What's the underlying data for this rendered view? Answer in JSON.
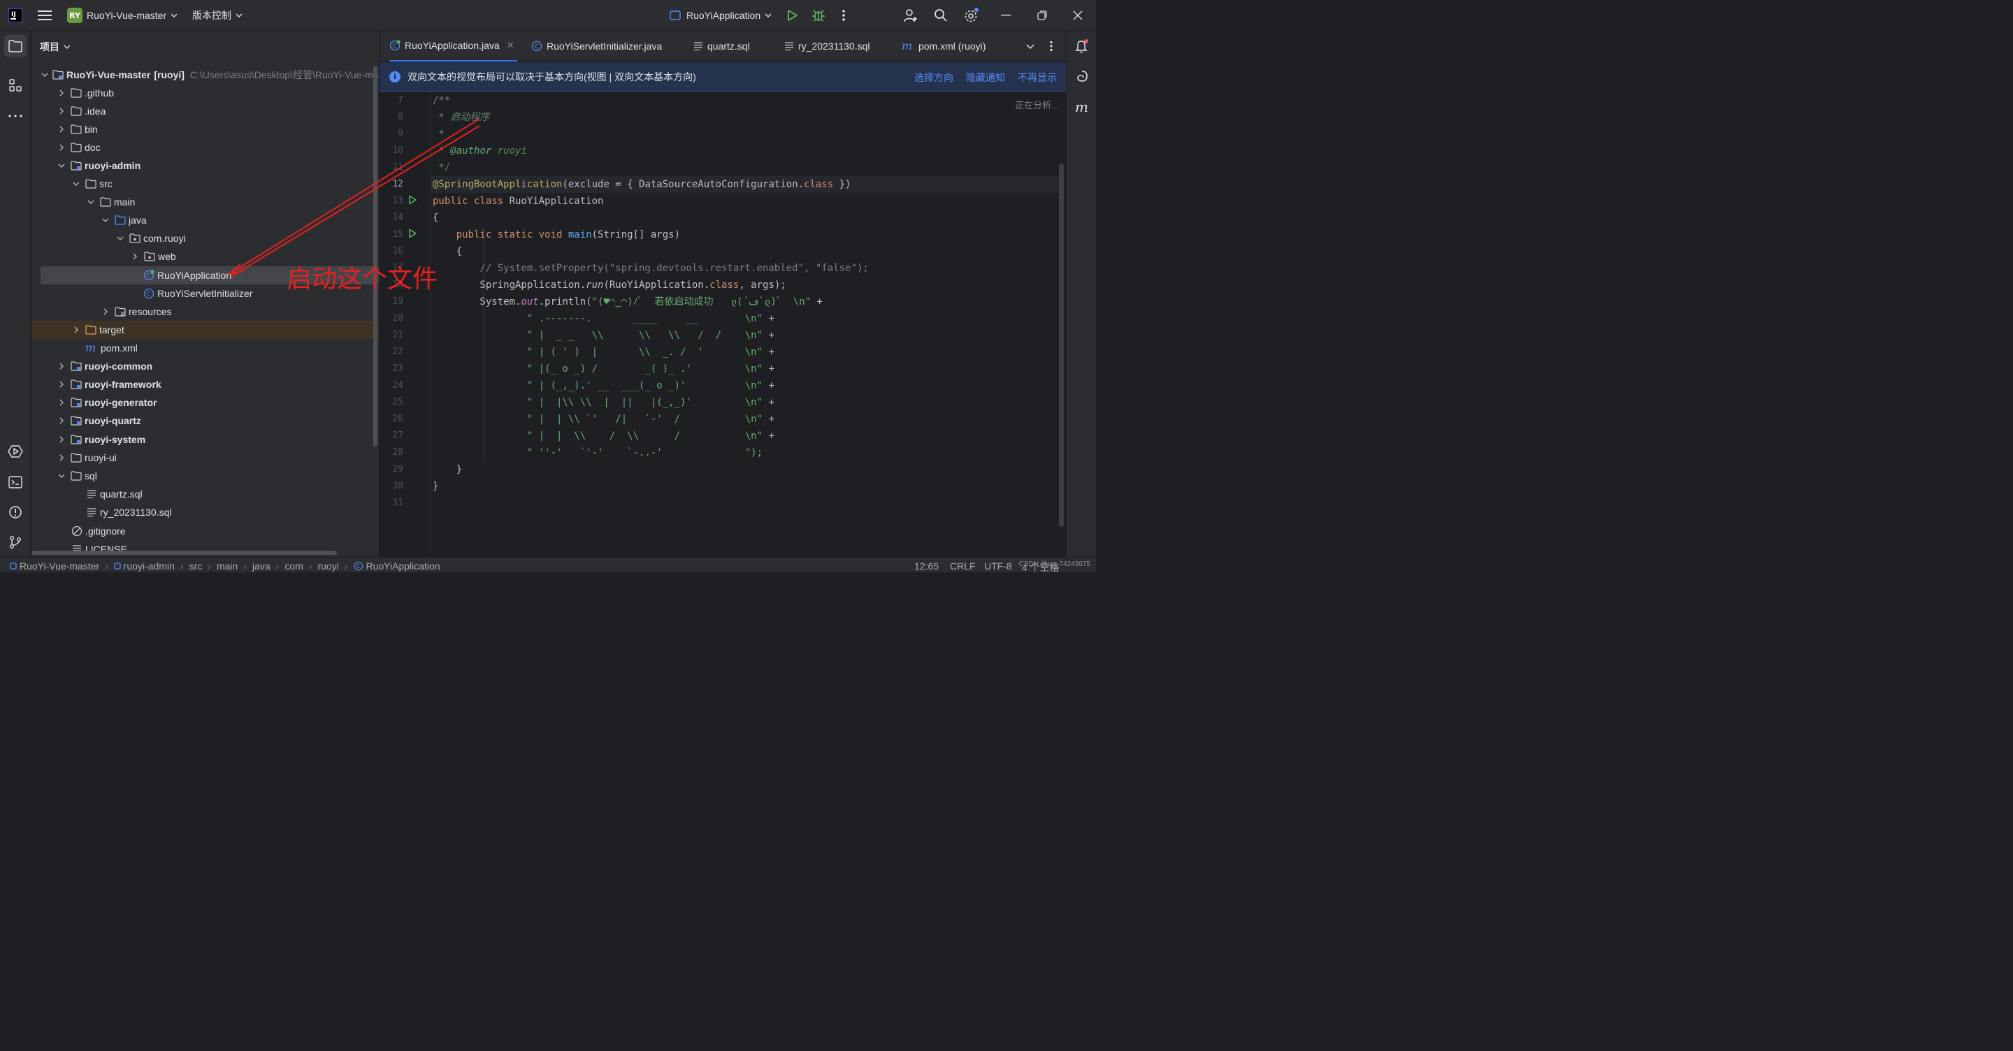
{
  "titlebar": {
    "project_badge": "RY",
    "project_name": "RuoYi-Vue-master",
    "vcs_label": "版本控制",
    "run_config": "RuoYiApplication"
  },
  "panel": {
    "title": "项目",
    "tree": [
      {
        "id": "root",
        "label": "RuoYi-Vue-master",
        "suffix": "[ruoyi]",
        "hint": "C:\\Users\\asus\\Desktop\\经管\\RuoYi-Vue-mas"
      },
      {
        "id": "github",
        "label": ".github"
      },
      {
        "id": "idea",
        "label": ".idea"
      },
      {
        "id": "bin",
        "label": "bin"
      },
      {
        "id": "doc",
        "label": "doc"
      },
      {
        "id": "admin",
        "label": "ruoyi-admin"
      },
      {
        "id": "src",
        "label": "src"
      },
      {
        "id": "main",
        "label": "main"
      },
      {
        "id": "java",
        "label": "java"
      },
      {
        "id": "comruoyi",
        "label": "com.ruoyi"
      },
      {
        "id": "web",
        "label": "web"
      },
      {
        "id": "ruoyiapp",
        "label": "RuoYiApplication"
      },
      {
        "id": "servletinit",
        "label": "RuoYiServletInitializer"
      },
      {
        "id": "resources",
        "label": "resources"
      },
      {
        "id": "target",
        "label": "target"
      },
      {
        "id": "pom",
        "label": "pom.xml"
      },
      {
        "id": "common",
        "label": "ruoyi-common"
      },
      {
        "id": "framework",
        "label": "ruoyi-framework"
      },
      {
        "id": "generator",
        "label": "ruoyi-generator"
      },
      {
        "id": "quartz",
        "label": "ruoyi-quartz"
      },
      {
        "id": "system",
        "label": "ruoyi-system"
      },
      {
        "id": "ui",
        "label": "ruoyi-ui"
      },
      {
        "id": "sql",
        "label": "sql"
      },
      {
        "id": "quartzsql",
        "label": "quartz.sql"
      },
      {
        "id": "rysql",
        "label": "ry_20231130.sql"
      },
      {
        "id": "gitignore",
        "label": ".gitignore"
      },
      {
        "id": "license",
        "label": "LICENSE"
      }
    ]
  },
  "tabs": [
    {
      "label": "RuoYiApplication.java",
      "icon": "java-class-icon",
      "active": true
    },
    {
      "label": "RuoYiServletInitializer.java",
      "icon": "java-class-icon"
    },
    {
      "label": "quartz.sql",
      "icon": "sql-file-icon"
    },
    {
      "label": "ry_20231130.sql",
      "icon": "sql-file-icon"
    },
    {
      "label": "pom.xml (ruoyi)",
      "icon": "maven-icon"
    }
  ],
  "notification": {
    "text": "双向文本的视觉布局可以取决于基本方向(视图 | 双向文本基本方向)",
    "action_choose": "选择方向",
    "action_hide": "隐藏通知",
    "action_never": "不再显示"
  },
  "editor": {
    "analysing": "正在分析...",
    "line_numbers": [
      "7",
      "8",
      "9",
      "10",
      "11",
      "12",
      "13",
      "14",
      "15",
      "16",
      "17",
      "18",
      "19",
      "20",
      "21",
      "22",
      "23",
      "24",
      "25",
      "26",
      "27",
      "28",
      "29",
      "30",
      "31"
    ],
    "code": {
      "l7": "/**",
      "l8_star": " * ",
      "l8_doc": "启动程序",
      "l9": " *",
      "l10_star": " * ",
      "l10_tag": "@author",
      "l10_val": " ruoyi",
      "l11": " */",
      "l12_ann": "@SpringBootApplication",
      "l12_rest": "(exclude = { DataSourceAutoConfiguration.",
      "l12_kw": "class",
      "l12_end": " })",
      "l13_kw": "public class",
      "l13_name": " RuoYiApplication",
      "l14": "{",
      "l15_kw": "    public static void",
      "l15_fn": " main",
      "l15_rest": "(String[] args)",
      "l16": "    {",
      "l17": "        // System.setProperty(\"spring.devtools.restart.enabled\", \"false\");",
      "l18_a": "        SpringApplication.",
      "l18_run": "run",
      "l18_b": "(RuoYiApplication.",
      "l18_kw": "class",
      "l18_c": ", args);",
      "l19_a": "        System.",
      "l19_out": "out",
      "l19_b": ".println(",
      "l19_str": "\"(♥◠‿◠)ﾉﾞ  若依启动成功   ლ(´ڡ`ლ)ﾞ  \\n\"",
      "l19_c": " +",
      "l20_str": "                \" .-------.       ____     __        \\n\"",
      "l21_str": "                \" |  _ _   \\\\      \\\\   \\\\   /  /    \\n\"",
      "l22_str": "                \" | ( ' )  |       \\\\  _. /  '       \\n\"",
      "l23_str": "                \" |(_ o _) /        _( )_ .'         \\n\"",
      "l24_str": "                \" | (_,_).' __  ___(_ o _)'          \\n\"",
      "l25_str": "                \" |  |\\\\ \\\\  |  ||   |(_,_)'         \\n\"",
      "l26_str": "                \" |  | \\\\ `'   /|   `-'  /           \\n\"",
      "l27_str": "                \" |  |  \\\\    /  \\\\      /           \\n\"",
      "l28_str": "                \" ''-'   `'-'    `-..-'              \");",
      "plus": " +",
      "l29": "    }",
      "l30": "}"
    }
  },
  "annotation": {
    "text": "启动这个文件",
    "color": "#e8201e"
  },
  "statusbar": {
    "crumbs": [
      "RuoYi-Vue-master",
      "ruoyi-admin",
      "src",
      "main",
      "java",
      "com",
      "ruoyi",
      "RuoYiApplication"
    ],
    "position": "12:65",
    "line_sep": "CRLF",
    "encoding": "UTF-8",
    "indent": "4 个空格",
    "watermark": "CSDN @qq_74242675"
  },
  "colors": {
    "accent": "#3574f0",
    "editor_bg": "#1e1f22",
    "panel_bg": "#2b2d30"
  }
}
